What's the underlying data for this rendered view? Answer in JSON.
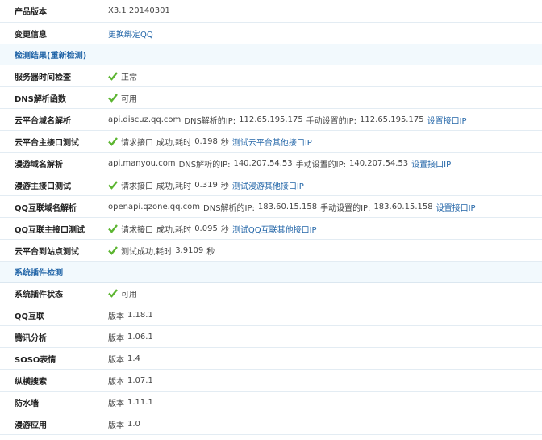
{
  "info": {
    "product_version": {
      "label": "产品版本",
      "value": "X3.1 20140301"
    },
    "change_info": {
      "label": "变更信息",
      "link": "更换绑定QQ"
    }
  },
  "detection": {
    "section_title": "检测结果(重新检测)",
    "server_time": {
      "label": "服务器时间检查",
      "status": "正常"
    },
    "dns_function": {
      "label": "DNS解析函数",
      "status": "可用"
    },
    "cloud_domain": {
      "label": "云平台域名解析",
      "domain": "api.discuz.qq.com",
      "dns_text": "DNS解析的IP:",
      "dns_ip": "112.65.195.175",
      "manual_text": "手动设置的IP:",
      "manual_ip": "112.65.195.175",
      "link": "设置接口IP"
    },
    "cloud_api": {
      "label": "云平台主接口测试",
      "request": "请求接口",
      "result": "成功,耗时",
      "time": "0.198",
      "unit": "秒",
      "link": "测试云平台其他接口IP"
    },
    "manyou_domain": {
      "label": "漫游域名解析",
      "domain": "api.manyou.com",
      "dns_text": "DNS解析的IP:",
      "dns_ip": "140.207.54.53",
      "manual_text": "手动设置的IP:",
      "manual_ip": "140.207.54.53",
      "link": "设置接口IP"
    },
    "manyou_api": {
      "label": "漫游主接口测试",
      "request": "请求接口",
      "result": "成功,耗时",
      "time": "0.319",
      "unit": "秒",
      "link": "测试漫游其他接口IP"
    },
    "qq_domain": {
      "label": "QQ互联域名解析",
      "domain": "openapi.qzone.qq.com",
      "dns_text": "DNS解析的IP:",
      "dns_ip": "183.60.15.158",
      "manual_text": "手动设置的IP:",
      "manual_ip": "183.60.15.158",
      "link": "设置接口IP"
    },
    "qq_api": {
      "label": "QQ互联主接口测试",
      "request": "请求接口",
      "result": "成功,耗时",
      "time": "0.095",
      "unit": "秒",
      "link": "测试QQ互联其他接口IP"
    },
    "site_test": {
      "label": "云平台到站点测试",
      "result": "测试成功,耗时",
      "time": "3.9109",
      "unit": "秒"
    }
  },
  "plugins": {
    "section_title": "系统插件检测",
    "status": {
      "label": "系统插件状态",
      "value": "可用"
    },
    "version_prefix": "版本",
    "items": [
      {
        "label": "QQ互联",
        "version": "1.18.1"
      },
      {
        "label": "腾讯分析",
        "version": "1.06.1"
      },
      {
        "label": "SOSO表情",
        "version": "1.4"
      },
      {
        "label": "纵横搜索",
        "version": "1.07.1"
      },
      {
        "label": "防水墙",
        "version": "1.11.1"
      },
      {
        "label": "漫游应用",
        "version": "1.0"
      }
    ]
  },
  "colors": {
    "link": "#2366a8",
    "check": "#5cb531",
    "section_bg": "#f2f9fd"
  },
  "icons": {
    "ok": "check-icon"
  }
}
